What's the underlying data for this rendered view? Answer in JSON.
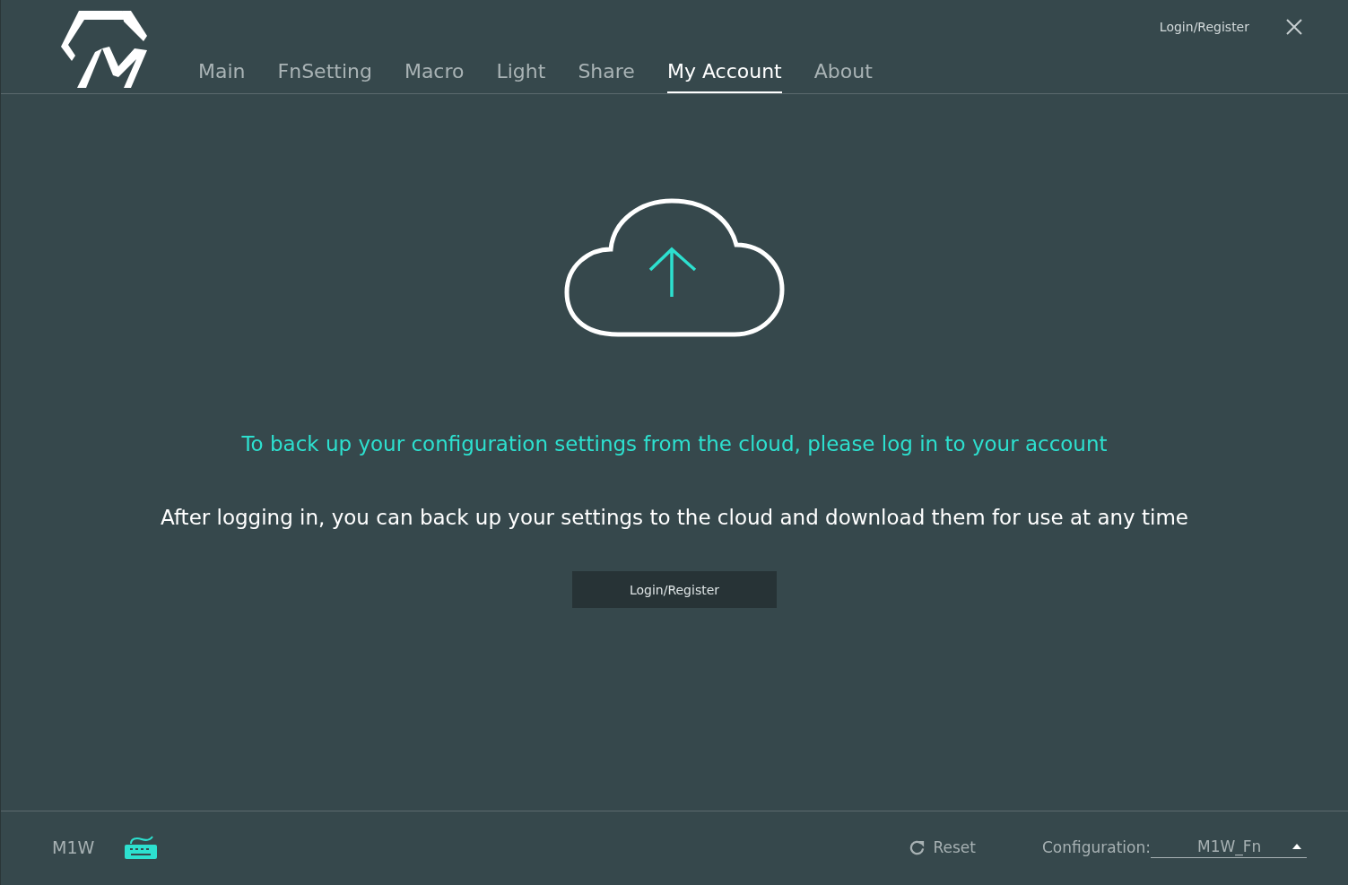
{
  "header": {
    "tabs": [
      {
        "label": "Main",
        "selected": false
      },
      {
        "label": "FnSetting",
        "selected": false
      },
      {
        "label": "Macro",
        "selected": false
      },
      {
        "label": "Light",
        "selected": false
      },
      {
        "label": "Share",
        "selected": false
      },
      {
        "label": "My Account",
        "selected": true
      },
      {
        "label": "About",
        "selected": false
      }
    ],
    "login_link": "Login/Register"
  },
  "content": {
    "headline": "To back up your configuration settings from the cloud, please log in to your account",
    "description": "After logging in, you can back up your settings to the cloud and download them for use at any time",
    "button": "Login/Register"
  },
  "status_bar": {
    "device": "M1W",
    "reset": "Reset",
    "configuration_label": "Configuration:",
    "configuration_value": "M1W_Fn"
  }
}
